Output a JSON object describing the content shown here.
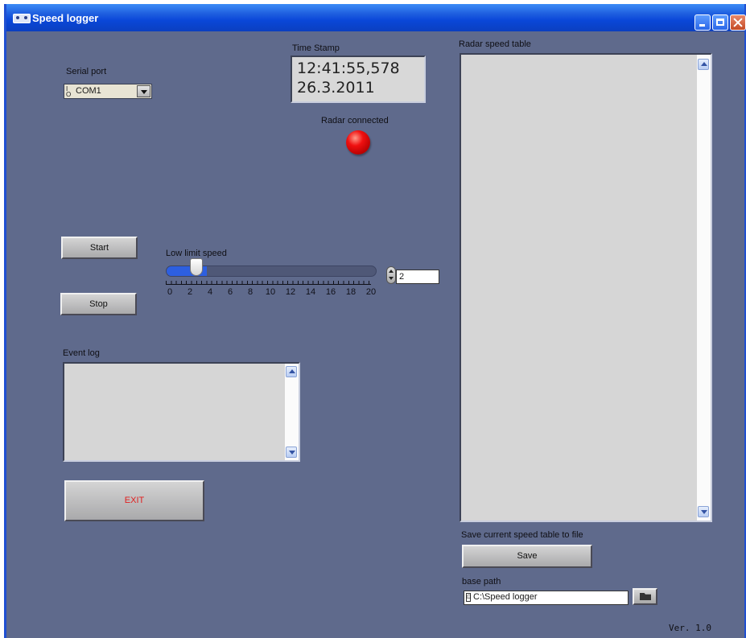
{
  "window": {
    "title": "Speed logger"
  },
  "serial_port": {
    "label": "Serial port",
    "value": "COM1",
    "io_glyph": "I/O"
  },
  "timestamp": {
    "label": "Time Stamp",
    "time": "12:41:55,578",
    "date": "26.3.2011"
  },
  "radar": {
    "label": "Radar connected",
    "led_color": "#e00000"
  },
  "buttons": {
    "start": "Start",
    "stop": "Stop",
    "exit": "EXIT",
    "save": "Save"
  },
  "low_limit": {
    "label": "Low limit speed",
    "value": "2",
    "slider_fraction": 0.1,
    "tick_labels": [
      "0",
      "2",
      "4",
      "6",
      "8",
      "10",
      "12",
      "14",
      "16",
      "18",
      "20"
    ]
  },
  "event_log": {
    "label": "Event log"
  },
  "speed_table": {
    "label": "Radar speed table"
  },
  "save_section": {
    "label": "Save current speed table to file"
  },
  "base_path": {
    "label": "base path",
    "value": "C:\\Speed logger"
  },
  "version": "Ver. 1.0",
  "colors": {
    "panel": "#5f6a8c",
    "exit_text": "#e02020",
    "slider_fill": "#2d5fe0"
  }
}
